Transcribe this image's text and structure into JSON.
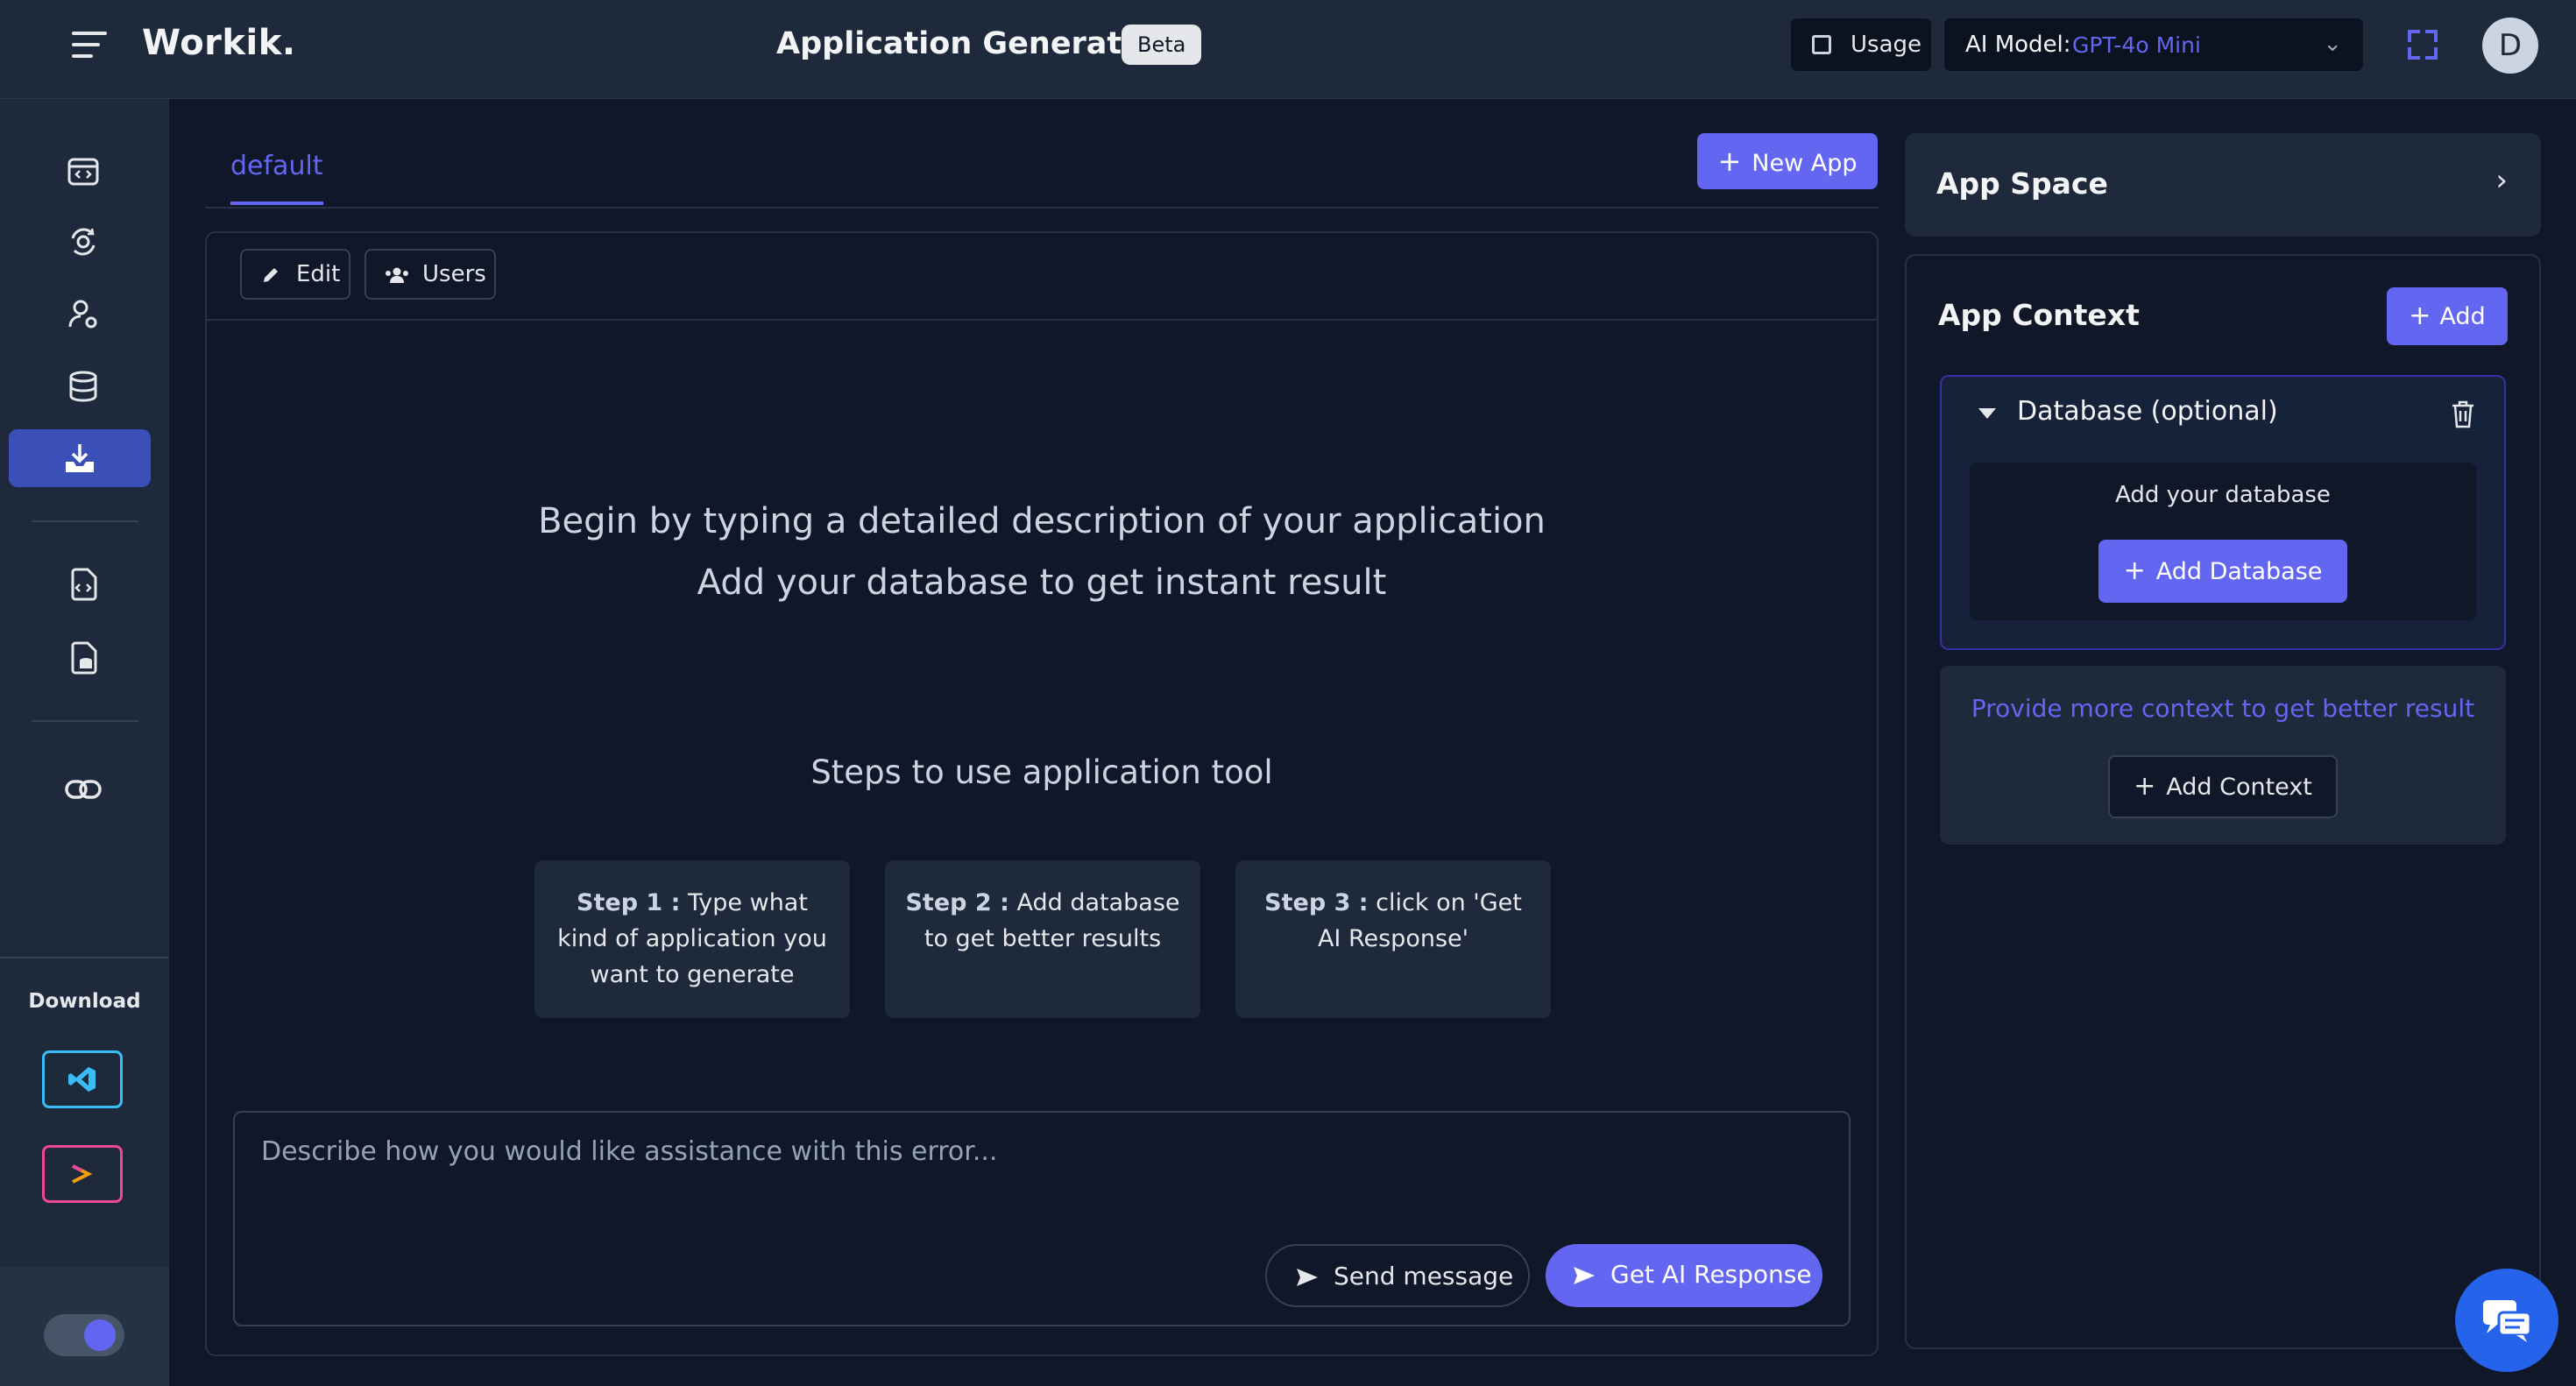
{
  "header": {
    "logo": "Workik.",
    "title": "Application Generator",
    "badge": "Beta",
    "usage_label": "Usage",
    "model_label": "AI Model:",
    "model_value": "GPT-4o Mini",
    "avatar_initial": "D"
  },
  "sidebar": {
    "icons": [
      "calendar-code-icon",
      "api-sync-icon",
      "user-settings-icon",
      "database-icon",
      "download-tray-icon",
      "doc-code-icon",
      "doc-db-icon",
      "link-icon"
    ],
    "active_index": 4,
    "download_label": "Download",
    "download_targets": [
      "vscode-icon",
      "jetbrains-icon"
    ]
  },
  "workspace": {
    "tab": "default",
    "new_app_label": "New App",
    "edit_label": "Edit",
    "users_label": "Users",
    "intro_line1": "Begin by typing a detailed description of your application",
    "intro_line2": "Add your database to get instant result",
    "steps_title": "Steps to use application tool",
    "steps": [
      {
        "label": "Step 1 :",
        "text": "Type what kind of application you want to generate"
      },
      {
        "label": "Step 2 :",
        "text": "Add database to get better results"
      },
      {
        "label": "Step 3 :",
        "text": "click on 'Get AI Response'"
      }
    ],
    "chat_placeholder": "Describe how you would like assistance with this error...",
    "send_label": "Send message",
    "ai_label": "Get AI Response"
  },
  "right_panel": {
    "app_space": "App Space",
    "context_title": "App Context",
    "add_label": "Add",
    "db_title": "Database (optional)",
    "db_prompt": "Add your database",
    "add_db_label": "Add Database",
    "more_context": "Provide more context to get better result",
    "add_context_label": "Add Context"
  },
  "colors": {
    "accent": "#6366f1",
    "background": "#0f1729",
    "surface": "#1e293b"
  }
}
